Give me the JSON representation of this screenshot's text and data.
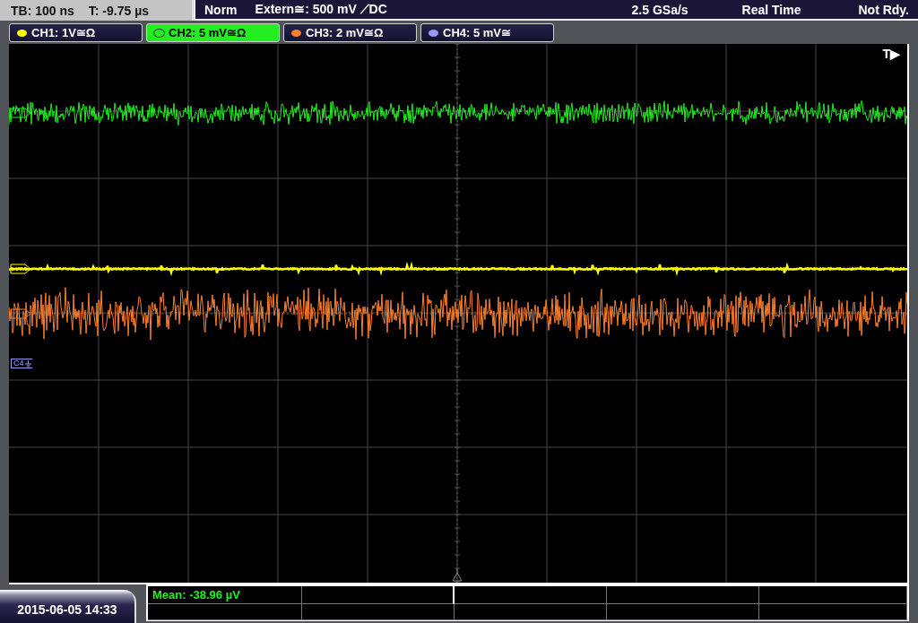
{
  "status_bar": {
    "timebase": "TB: 100 ns",
    "trigger_time": "T: -9.75 µs",
    "mode": "Norm",
    "trigger": "Extern≅: 500 mV ⟋DC",
    "sample_rate": "2.5 GSa/s",
    "acquisition": "Real Time",
    "state": "Not Rdy."
  },
  "channels": [
    {
      "label": "CH1: 1V≅Ω",
      "selected": false,
      "color": "#ffff00"
    },
    {
      "label": "CH2: 5 mV≅Ω",
      "selected": true,
      "color": "#22ee22"
    },
    {
      "label": "CH3: 2 mV≅Ω",
      "selected": false,
      "color": "#ff7f2a"
    },
    {
      "label": "CH4: 5 mV≅",
      "selected": false,
      "color": "#9a9aff",
      "marker": "C4"
    }
  ],
  "trigger_marker": "T▶",
  "measurement": "Mean: -38.96 µV",
  "timestamp": "2015-06-05 14:33"
}
